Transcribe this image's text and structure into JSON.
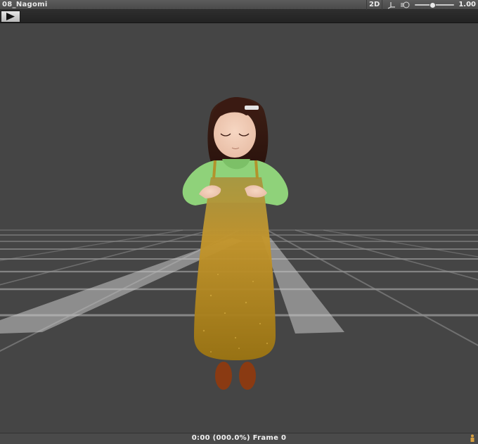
{
  "window": {
    "title": "08_Nagomi",
    "mode_label": "2D",
    "zoom_value": "1.00",
    "zoom_fraction": 0.45
  },
  "toolbar": {
    "play_icon": "play-icon"
  },
  "status": {
    "frame_readout": "0:00 (000.0%) Frame 0"
  },
  "colors": {
    "viewport_bg": "#454545",
    "grid": "#9a9a9a",
    "sweater": "#8fd27a",
    "dress": "#b58c23",
    "shoes": "#8a3a12",
    "hair": "#3a1a12"
  }
}
